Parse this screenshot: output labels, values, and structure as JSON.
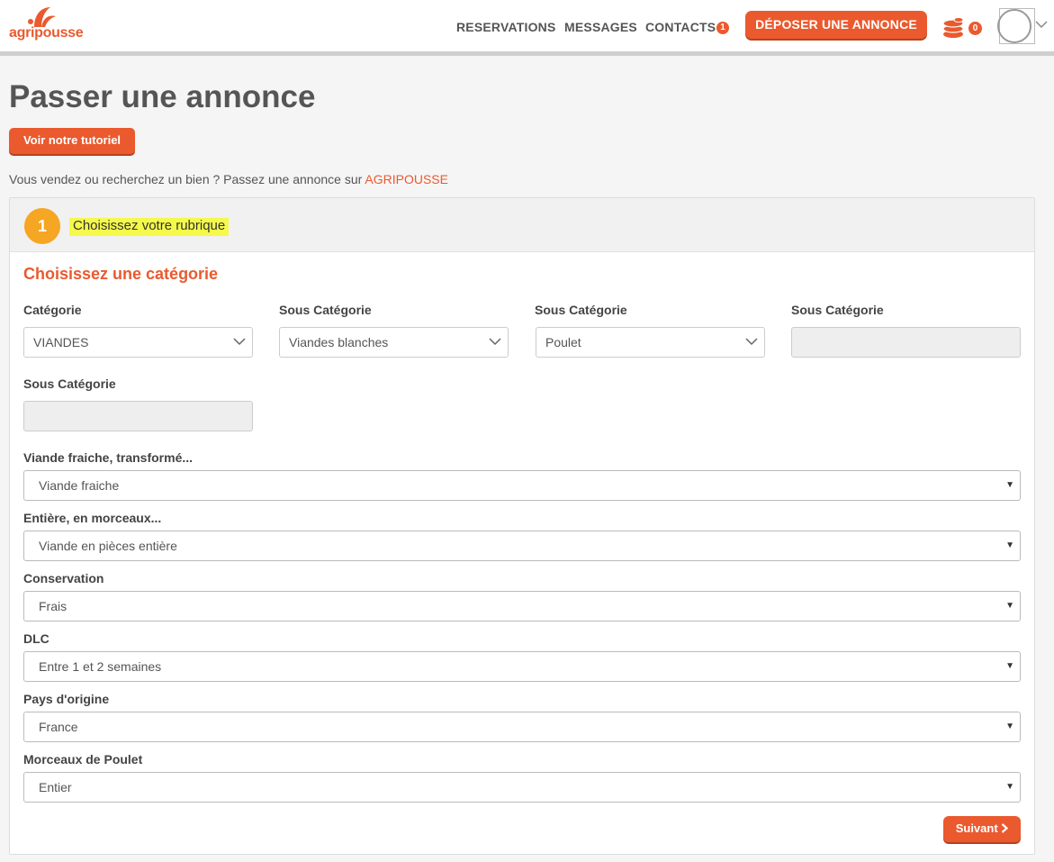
{
  "header": {
    "logo_text": "agripousse",
    "nav": {
      "reservations": "RESERVATIONS",
      "messages": "MESSAGES",
      "contacts": "CONTACTS",
      "contacts_badge": "1"
    },
    "deposit_label": "DÉPOSER UNE ANNONCE",
    "coins_count": "0"
  },
  "page": {
    "title": "Passer une annonce",
    "tutorial_label": "Voir notre tutoriel",
    "intro_text": "Vous vendez ou recherchez un bien ? Passez une annonce sur ",
    "intro_brand": "AGRIPOUSSE"
  },
  "step": {
    "number": "1",
    "title": "Choisissez votre rubrique",
    "section_title": "Choisissez une catégorie"
  },
  "categories": [
    {
      "label": "Catégorie",
      "value": "VIANDES"
    },
    {
      "label": "Sous Catégorie",
      "value": "Viandes blanches"
    },
    {
      "label": "Sous Catégorie",
      "value": "Poulet"
    },
    {
      "label": "Sous Catégorie",
      "value": ""
    },
    {
      "label": "Sous Catégorie",
      "value": ""
    }
  ],
  "attributes": [
    {
      "label": "Viande fraiche, transformé...",
      "value": "Viande fraiche"
    },
    {
      "label": "Entière, en morceaux...",
      "value": "Viande en pièces entière"
    },
    {
      "label": "Conservation",
      "value": "Frais"
    },
    {
      "label": "DLC",
      "value": "Entre 1 et 2 semaines"
    },
    {
      "label": "Pays d'origine",
      "value": "France"
    },
    {
      "label": "Morceaux de Poulet",
      "value": "Entier"
    }
  ],
  "next_label": "Suivant",
  "colors": {
    "brand": "#ea5a2e",
    "step": "#f5a623",
    "highlight": "#f5f94a"
  }
}
